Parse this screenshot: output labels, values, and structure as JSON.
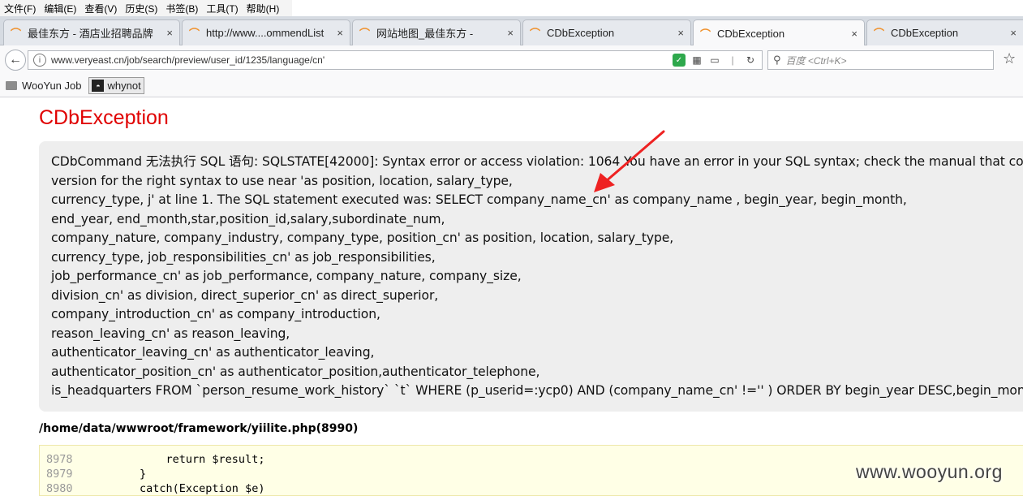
{
  "menu": [
    "文件(F)",
    "编辑(E)",
    "查看(V)",
    "历史(S)",
    "书签(B)",
    "工具(T)",
    "帮助(H)"
  ],
  "tabs": [
    {
      "label": "最佳东方 - 酒店业招聘品牌",
      "close": "×"
    },
    {
      "label": "http://www....ommendList",
      "close": "×"
    },
    {
      "label": "网站地图_最佳东方 -",
      "close": "×"
    },
    {
      "label": "CDbException",
      "close": "×"
    },
    {
      "label": "CDbException",
      "close": "×"
    },
    {
      "label": "CDbException",
      "close": "×"
    }
  ],
  "toolbar": {
    "url": "www.veryeast.cn/job/search/preview/user_id/1235/language/cn'",
    "search_placeholder": "百度 <Ctrl+K>"
  },
  "bookmarks": [
    {
      "label": "WooYun Job"
    },
    {
      "label": "whynot"
    }
  ],
  "page": {
    "title": "CDbException",
    "message_lines": [
      "CDbCommand 无法执行 SQL 语句: SQLSTATE[42000]: Syntax error or access violation: 1064 You have an error in your SQL syntax; check the manual that corre",
      "version for the right syntax to use near 'as position, location, salary_type,",
      "currency_type, j' at line 1. The SQL statement executed was: SELECT company_name_cn' as company_name , begin_year, begin_month,",
      "end_year, end_month,star,position_id,salary,subordinate_num,",
      "company_nature, company_industry, company_type, position_cn' as position, location, salary_type,",
      "currency_type, job_responsibilities_cn' as job_responsibilities,",
      "job_performance_cn' as job_performance, company_nature, company_size,",
      "division_cn' as division, direct_superior_cn' as direct_superior,",
      "company_introduction_cn' as company_introduction,",
      "reason_leaving_cn' as reason_leaving,",
      "authenticator_leaving_cn' as authenticator_leaving,",
      "authenticator_position_cn' as authenticator_position,authenticator_telephone,",
      "is_headquarters FROM `person_resume_work_history` `t` WHERE (p_userid=:ycp0) AND (company_name_cn' !='' ) ORDER BY begin_year DESC,begin_mont"
    ],
    "source_file": "/home/data/wwwroot/framework/yiilite.php(8990)",
    "code_lines": [
      {
        "num": "8978",
        "code": "            return $result;"
      },
      {
        "num": "8979",
        "code": "        }"
      },
      {
        "num": "8980",
        "code": "        catch(Exception $e)"
      }
    ]
  },
  "watermark": "www.wooyun.org",
  "colors": {
    "title": "#e00000",
    "arrow": "#ee2222"
  }
}
